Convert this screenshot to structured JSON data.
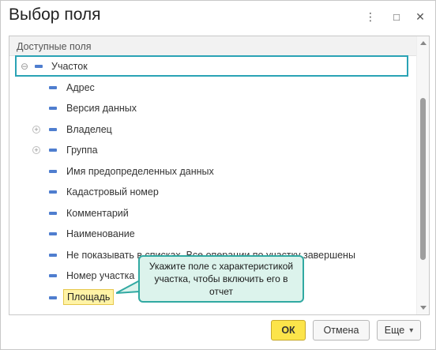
{
  "window": {
    "title": "Выбор поля",
    "menu_glyph": "⋮",
    "maximize_glyph": "□",
    "close_glyph": "✕"
  },
  "panel": {
    "header": "Доступные поля"
  },
  "tree": {
    "root": {
      "label": "Участок",
      "expander": "⊖"
    },
    "items": [
      {
        "label": "Адрес",
        "expander": ""
      },
      {
        "label": "Версия данных",
        "expander": ""
      },
      {
        "label": "Владелец",
        "expander": "+"
      },
      {
        "label": "Группа",
        "expander": "+"
      },
      {
        "label": "Имя предопределенных данных",
        "expander": ""
      },
      {
        "label": "Кадастровый номер",
        "expander": ""
      },
      {
        "label": "Комментарий",
        "expander": ""
      },
      {
        "label": "Наименование",
        "expander": ""
      },
      {
        "label": "Не показывать в списках. Все операции по участку завершены",
        "expander": ""
      },
      {
        "label": "Номер участка",
        "expander": ""
      },
      {
        "label": "Площадь",
        "expander": ""
      }
    ]
  },
  "callout": {
    "text": "Укажите поле с характеристикой участка, чтобы включить его в отчет"
  },
  "footer": {
    "ok_label": "ОК",
    "cancel_label": "Отмена",
    "more_label": "Еще",
    "more_arrow": "▾"
  },
  "colors": {
    "accent": "#2aa3b5",
    "ok_button": "#fce44a",
    "dash": "#4f7ecf",
    "callout_bg": "#dcf3ec"
  }
}
